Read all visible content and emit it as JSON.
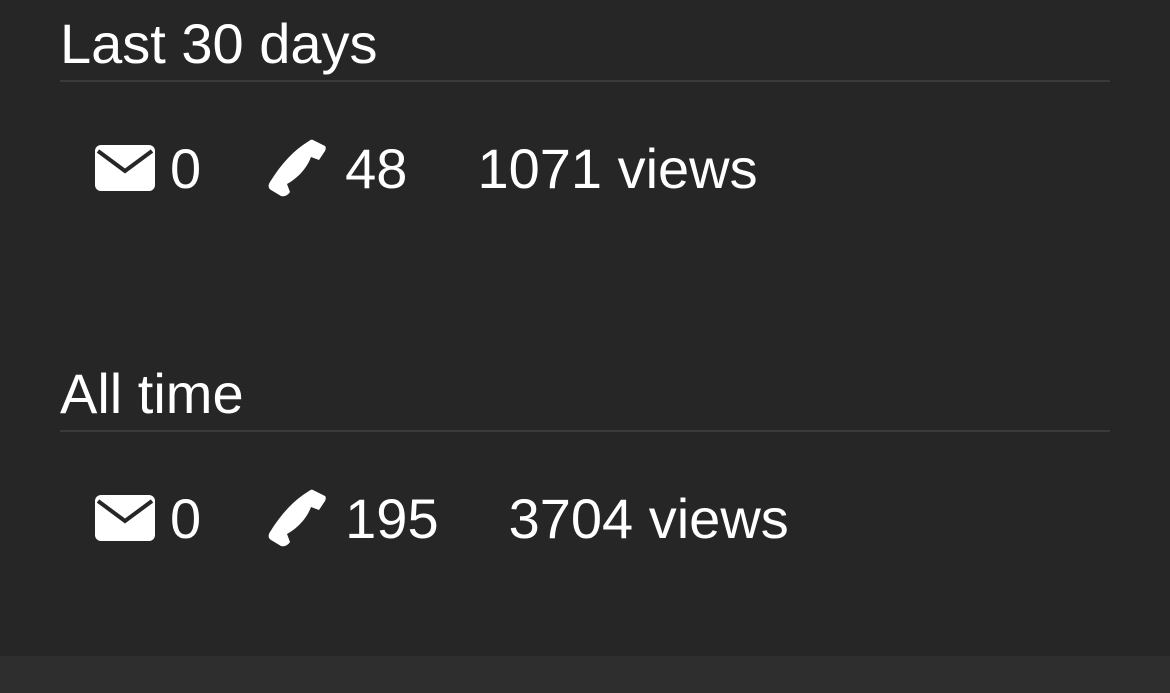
{
  "sections": [
    {
      "title": "Last 30 days",
      "mail_count": "0",
      "call_count": "48",
      "views": "1071 views"
    },
    {
      "title": "All time",
      "mail_count": "0",
      "call_count": "195",
      "views": "3704 views"
    }
  ],
  "icons": {
    "mail": "envelope-icon",
    "phone": "phone-icon"
  },
  "colors": {
    "background": "#262626",
    "text": "#ffffff",
    "divider": "#3a3a3a"
  }
}
